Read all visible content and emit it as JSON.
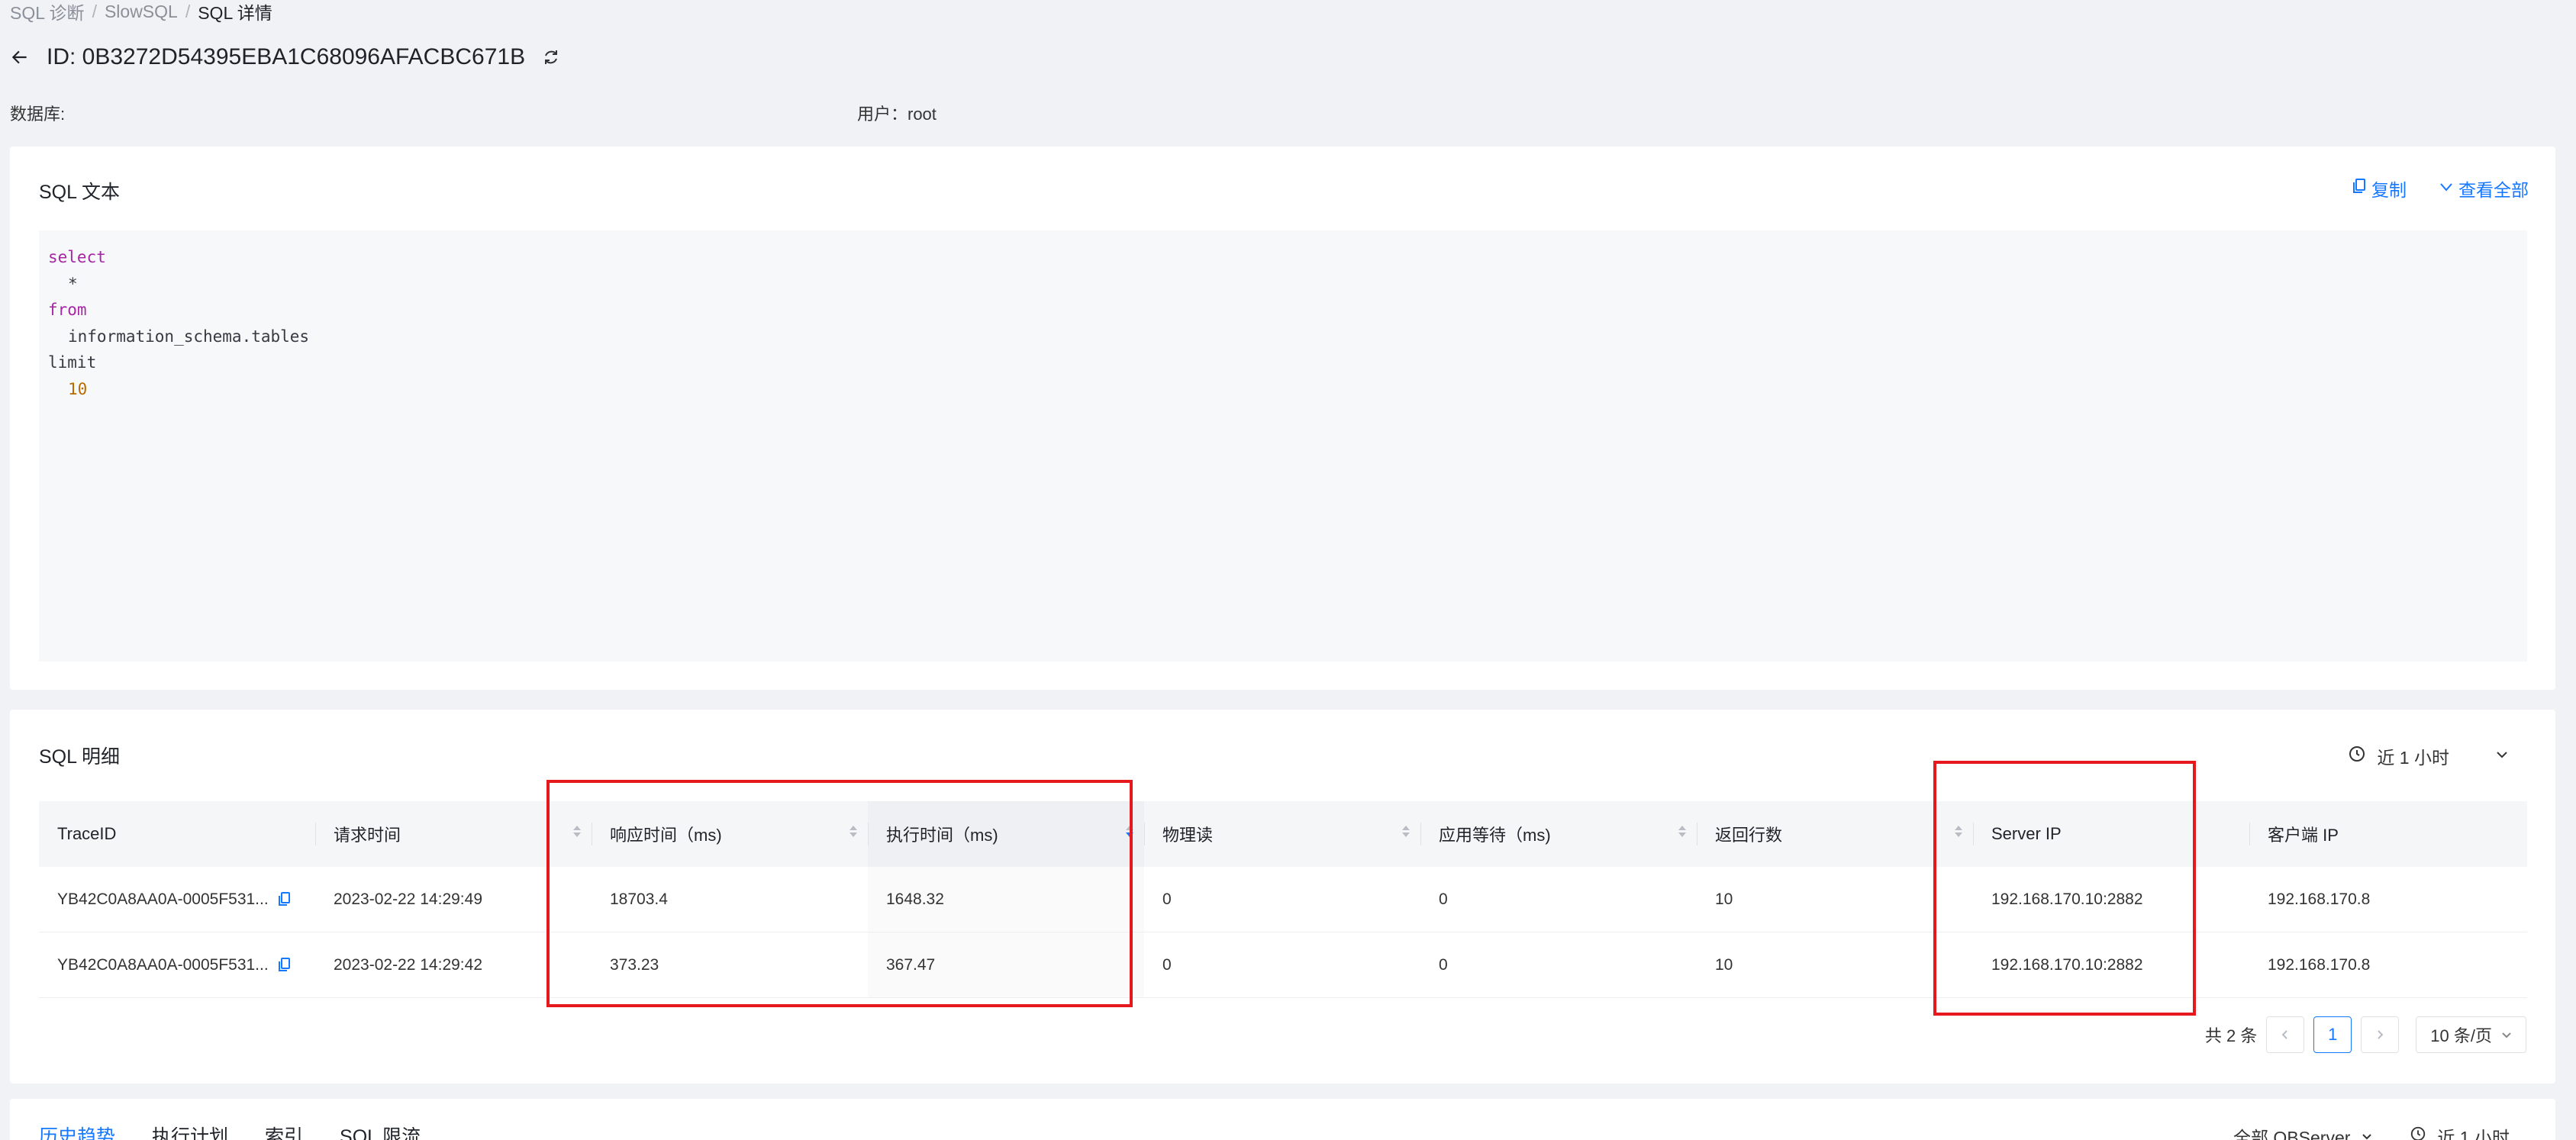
{
  "breadcrumb": [
    "SQL 诊断",
    "SlowSQL",
    "SQL 详情"
  ],
  "page_title": "ID: 0B3272D54395EBA1C68096AFACBC671B",
  "meta": {
    "database_label": "数据库:",
    "user_label": "用户：root"
  },
  "sql_card": {
    "title": "SQL 文本",
    "copy_label": "复制",
    "view_all_label": "查看全部",
    "code": [
      {
        "text": "select",
        "kind": "kw",
        "indent": 0
      },
      {
        "text": "*",
        "kind": "plain",
        "indent": 1
      },
      {
        "text": "from",
        "kind": "kw",
        "indent": 0
      },
      {
        "text": "information_schema.tables",
        "kind": "plain",
        "indent": 1
      },
      {
        "text": "limit",
        "kind": "plain",
        "indent": 0
      },
      {
        "text": "10",
        "kind": "num",
        "indent": 1
      }
    ]
  },
  "detail_card": {
    "title": "SQL 明细",
    "time_range": "近 1 小时",
    "columns": [
      "TraceID",
      "请求时间",
      "响应时间（ms)",
      "执行时间（ms)",
      "物理读",
      "应用等待（ms)",
      "返回行数",
      "Server IP",
      "客户端 IP"
    ],
    "rows": [
      [
        "YB42C0A8AA0A-0005F531...",
        "2023-02-22 14:29:49",
        "18703.4",
        "1648.32",
        "0",
        "0",
        "10",
        "192.168.170.10:2882",
        "192.168.170.8"
      ],
      [
        "YB42C0A8AA0A-0005F531...",
        "2023-02-22 14:29:42",
        "373.23",
        "367.47",
        "0",
        "0",
        "10",
        "192.168.170.10:2882",
        "192.168.170.8"
      ]
    ],
    "pagination": {
      "total_label": "共 2 条",
      "current_page": "1",
      "page_size_label": "10 条/页"
    }
  },
  "bottom_tabs": {
    "tabs": [
      "历史趋势",
      "执行计划",
      "索引",
      "SQL 限流"
    ],
    "server_filter": "全部 OBServer",
    "time_range": "近 1 小时"
  },
  "colors": {
    "accent": "#1677ff",
    "highlight": "#e5191d"
  }
}
